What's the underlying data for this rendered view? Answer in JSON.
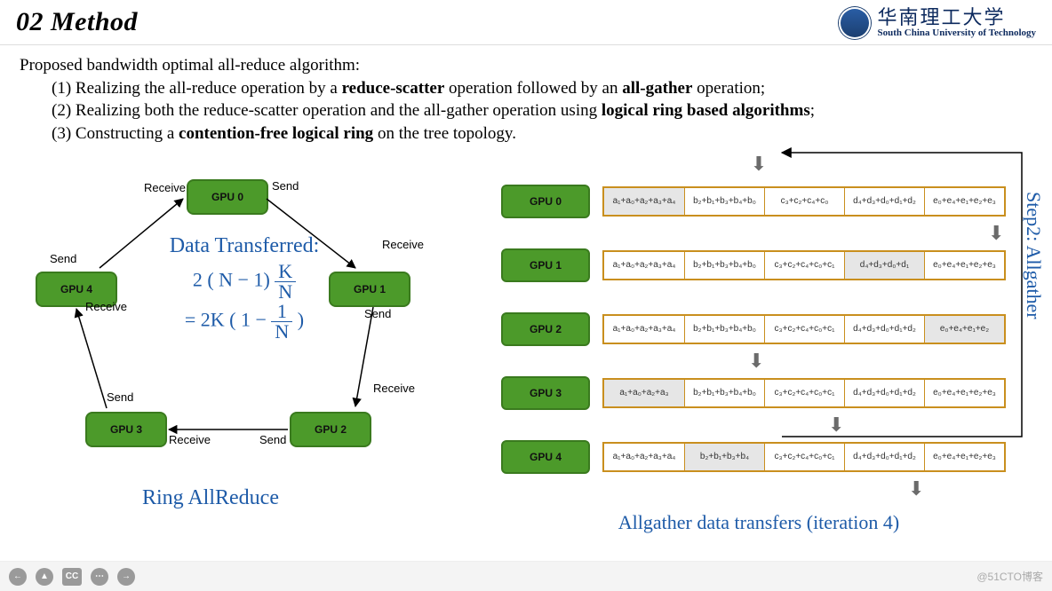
{
  "header": {
    "title": "02 Method",
    "uni_zh": "华南理工大学",
    "uni_en": "South China University of Technology"
  },
  "intro": {
    "lead": "Proposed bandwidth optimal all-reduce algorithm:",
    "p1a": "(1) Realizing the all-reduce operation by a ",
    "p1b": "reduce-scatter",
    "p1c": " operation followed by an ",
    "p1d": "all-gather",
    "p1e": " operation;",
    "p2a": "(2) Realizing both the reduce-scatter operation and the all-gather operation using ",
    "p2b": "logical ring based algorithms",
    "p2c": ";",
    "p3a": "(3) Constructing a ",
    "p3b": "contention-free logical ring",
    "p3c": " on the tree topology."
  },
  "ring": {
    "gpu0": "GPU 0",
    "gpu1": "GPU 1",
    "gpu2": "GPU 2",
    "gpu3": "GPU 3",
    "gpu4": "GPU 4",
    "send": "Send",
    "recv": "Receive",
    "title": "Data Transferred:",
    "l2_a": "2 ( N − 1) ",
    "l2_num": "K",
    "l2_den": "N",
    "l3_a": " = 2K ( 1 − ",
    "l3_num": "1",
    "l3_den": "N",
    "l3_b": " )",
    "caption": "Ring AllReduce"
  },
  "allgather": {
    "caption": "Allgather data transfers (iteration 4)",
    "step": "Step2: Allgather",
    "rows": [
      {
        "gpu": "GPU 0",
        "hl": 0,
        "cells": [
          "a₁+a₀+a₂+a₃+a₄",
          "b₂+b₁+b₃+b₄+b₀",
          "c₃+c₂+c₄+c₀",
          "d₄+d₃+d₀+d₁+d₂",
          "e₀+e₄+e₁+e₂+e₃"
        ]
      },
      {
        "gpu": "GPU 1",
        "hl": 3,
        "cells": [
          "a₁+a₀+a₂+a₃+a₄",
          "b₂+b₁+b₃+b₄+b₀",
          "c₃+c₂+c₄+c₀+c₁",
          "d₄+d₃+d₀+d₁",
          "e₀+e₄+e₁+e₂+e₃"
        ]
      },
      {
        "gpu": "GPU 2",
        "hl": 4,
        "cells": [
          "a₁+a₀+a₂+a₃+a₄",
          "b₂+b₁+b₃+b₄+b₀",
          "c₃+c₂+c₄+c₀+c₁",
          "d₄+d₃+d₀+d₁+d₂",
          "e₀+e₄+e₁+e₂"
        ]
      },
      {
        "gpu": "GPU 3",
        "hl": 0,
        "cells": [
          "a₁+a₀+a₂+a₃",
          "b₂+b₁+b₃+b₄+b₀",
          "c₃+c₂+c₄+c₀+c₁",
          "d₄+d₃+d₀+d₁+d₂",
          "e₀+e₄+e₁+e₂+e₃"
        ]
      },
      {
        "gpu": "GPU 4",
        "hl": 1,
        "cells": [
          "a₁+a₀+a₂+a₃+a₄",
          "b₂+b₁+b₃+b₄",
          "c₃+c₂+c₄+c₀+c₁",
          "d₄+d₃+d₀+d₁+d₂",
          "e₀+e₄+e₁+e₂+e₃"
        ]
      }
    ]
  },
  "footer": {
    "watermark": "@51CTO博客"
  }
}
